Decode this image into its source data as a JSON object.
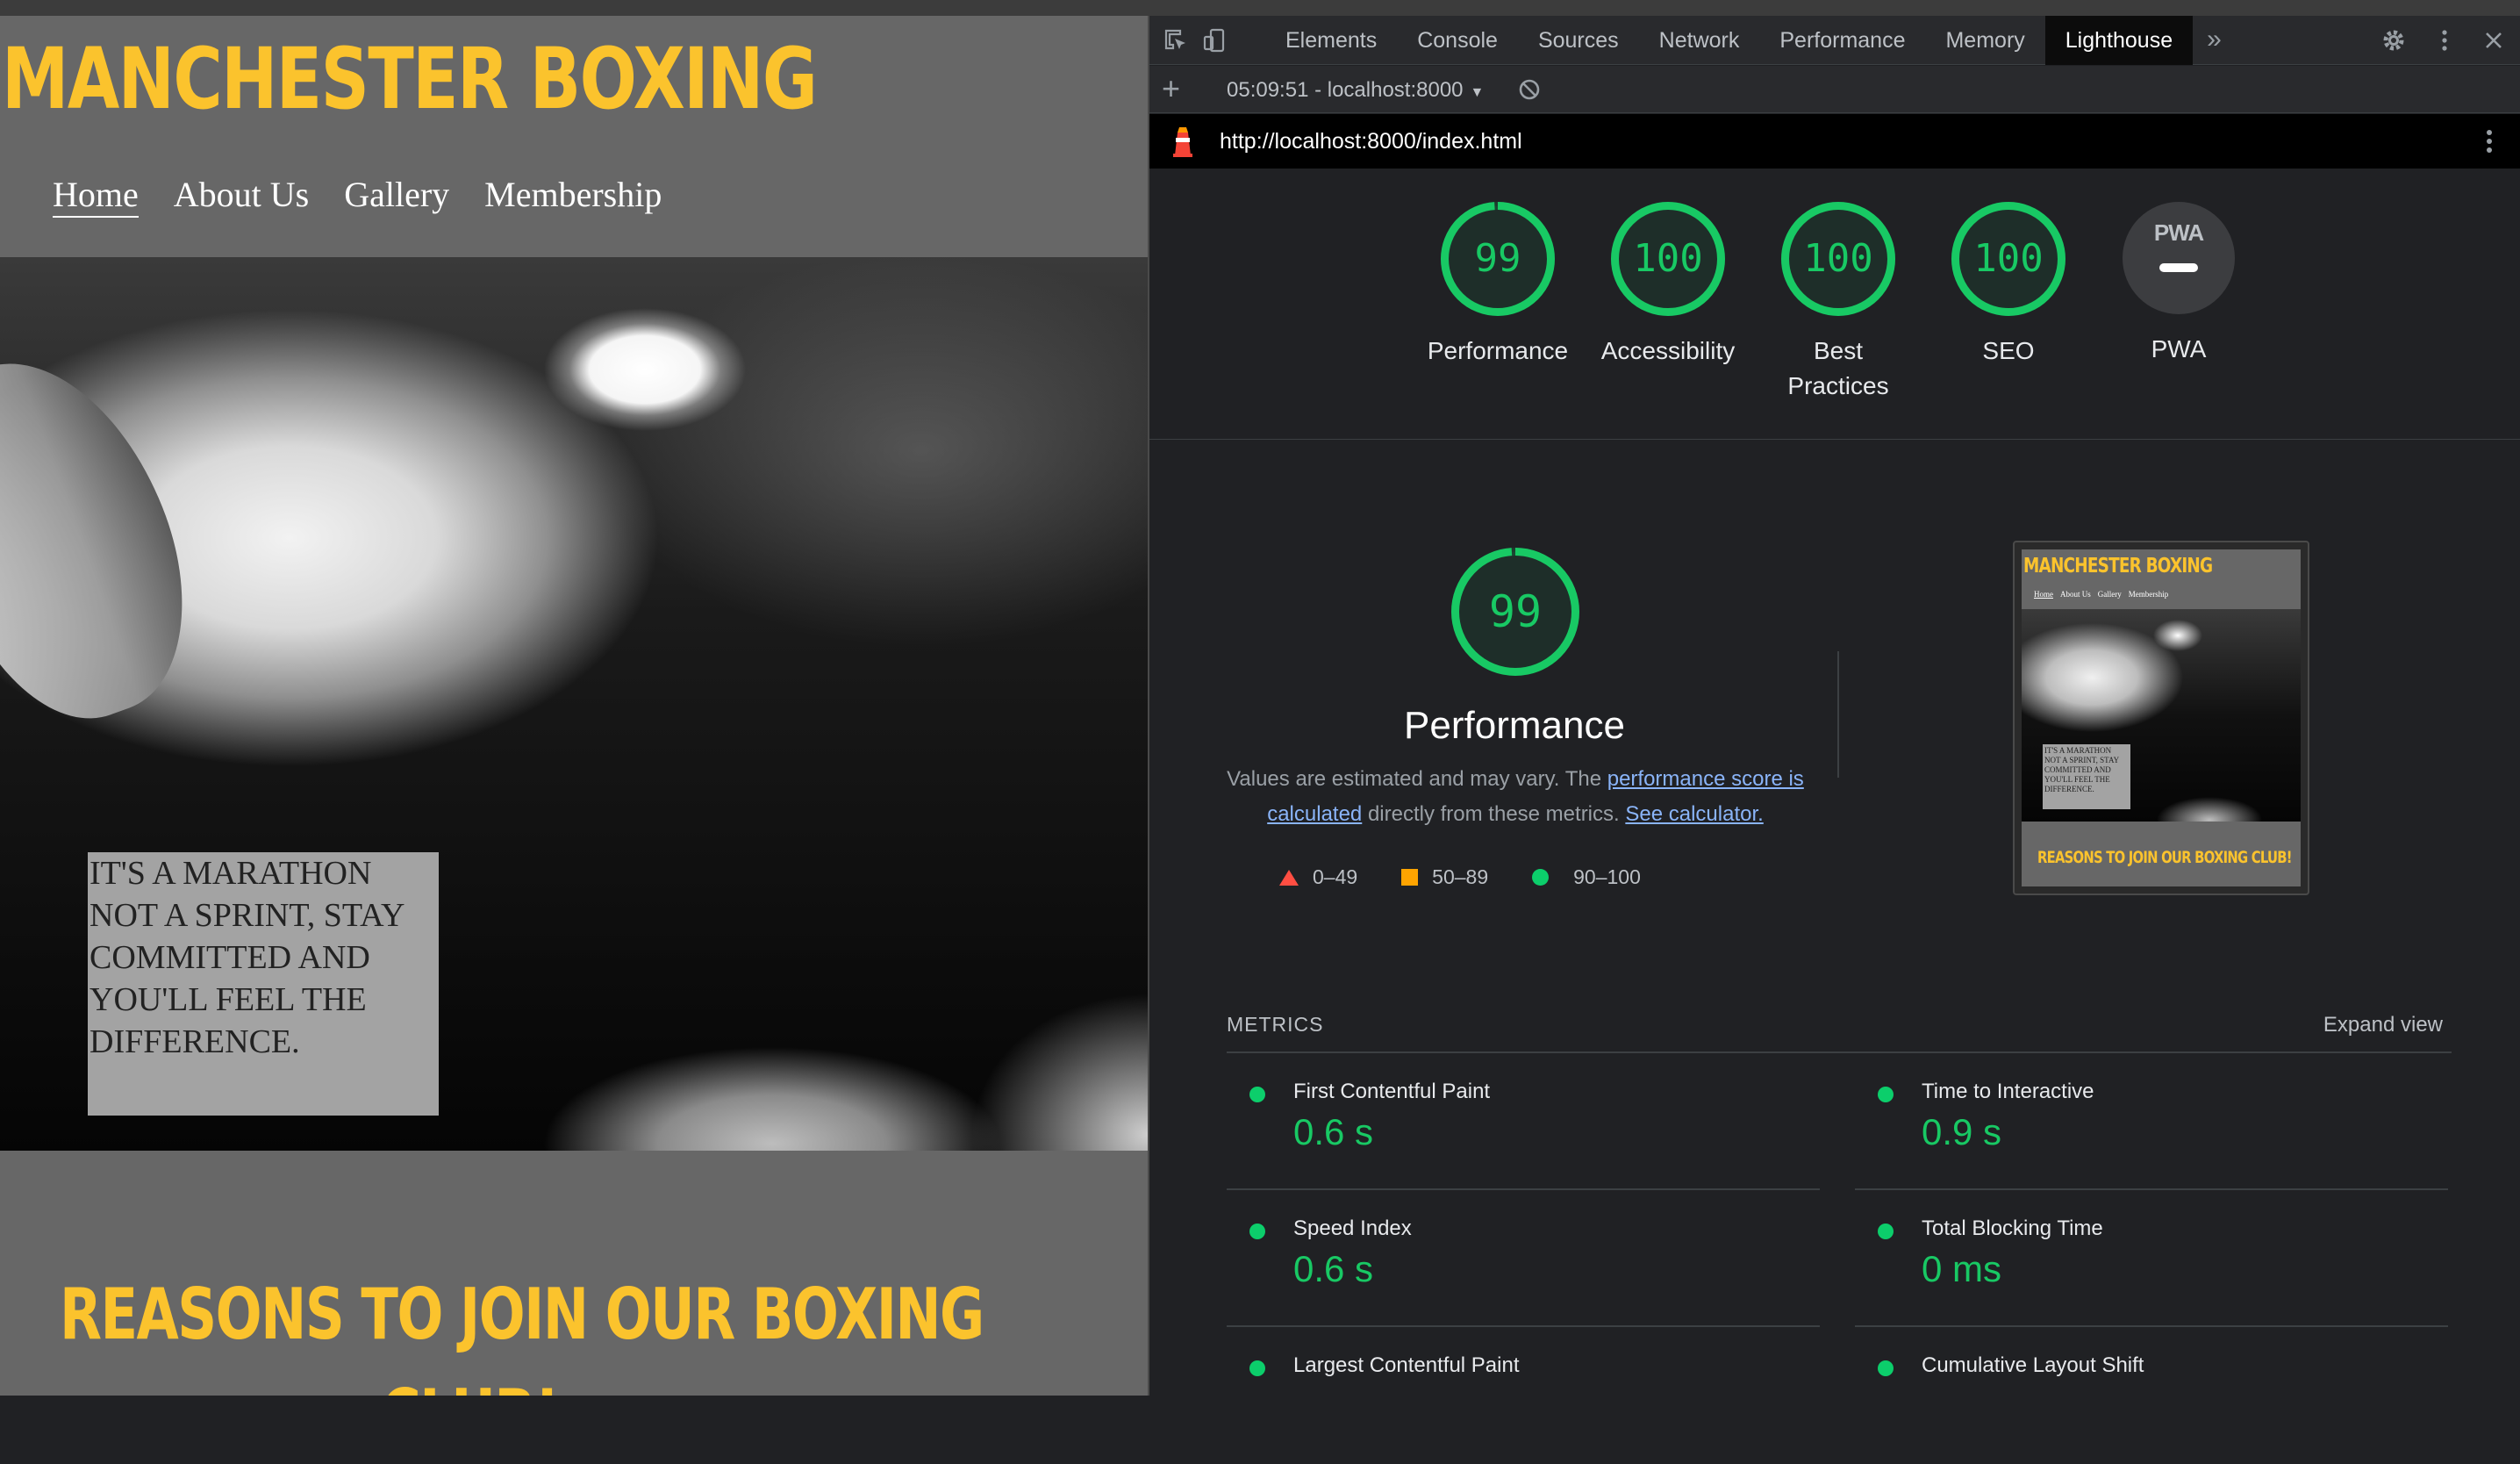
{
  "website": {
    "title": "MANCHESTER BOXING",
    "nav": [
      "Home",
      "About Us",
      "Gallery",
      "Membership"
    ],
    "quote": "IT'S A MARATHON NOT A SPRINT, STAY COMMITTED AND YOU'LL FEEL THE DIFFERENCE.",
    "reasons_line1": "REASONS TO JOIN OUR BOXING",
    "reasons_line2": "CLUB!"
  },
  "devtools": {
    "tabs": [
      "Elements",
      "Console",
      "Sources",
      "Network",
      "Performance",
      "Memory",
      "Lighthouse"
    ],
    "active_tab": "Lighthouse",
    "more_tabs": "»",
    "session": "05:09:51 - localhost:8000",
    "url": "http://localhost:8000/index.html"
  },
  "scores": [
    {
      "label": "Performance",
      "score": "99",
      "fraction": 0.99
    },
    {
      "label": "Accessibility",
      "score": "100",
      "fraction": 1.0
    },
    {
      "label": "Best Practices",
      "score": "100",
      "fraction": 1.0
    },
    {
      "label": "SEO",
      "score": "100",
      "fraction": 1.0
    }
  ],
  "pwa": {
    "label": "PWA",
    "badge": "PWA"
  },
  "performance": {
    "score": "99",
    "fraction": 0.99,
    "title": "Performance",
    "desc_1": "Values are estimated and may vary. The ",
    "desc_link": "performance score is calculated",
    "desc_2": " directly from these metrics. ",
    "calc_link": "See calculator.",
    "legend": [
      "0–49",
      "50–89",
      "90–100"
    ]
  },
  "thumbnail": {
    "title": "MANCHESTER BOXING",
    "nav": [
      "Home",
      "About Us",
      "Gallery",
      "Membership"
    ],
    "quote": "IT'S A MARATHON NOT A SPRINT, STAY COMMITTED AND YOU'LL FEEL THE DIFFERENCE.",
    "reasons": "REASONS TO JOIN OUR BOXING CLUB!"
  },
  "metrics": {
    "heading": "METRICS",
    "expand": "Expand view",
    "items": [
      {
        "name": "First Contentful Paint",
        "value": "0.6 s"
      },
      {
        "name": "Time to Interactive",
        "value": "0.9 s"
      },
      {
        "name": "Speed Index",
        "value": "0.6 s"
      },
      {
        "name": "Total Blocking Time",
        "value": "0 ms"
      },
      {
        "name": "Largest Contentful Paint",
        "value": ""
      },
      {
        "name": "Cumulative Layout Shift",
        "value": ""
      }
    ]
  },
  "colors": {
    "brand_yellow": "#fbc32d",
    "score_green": "#18c964",
    "fail_red": "#ff4e42",
    "average_orange": "#ffa400"
  }
}
